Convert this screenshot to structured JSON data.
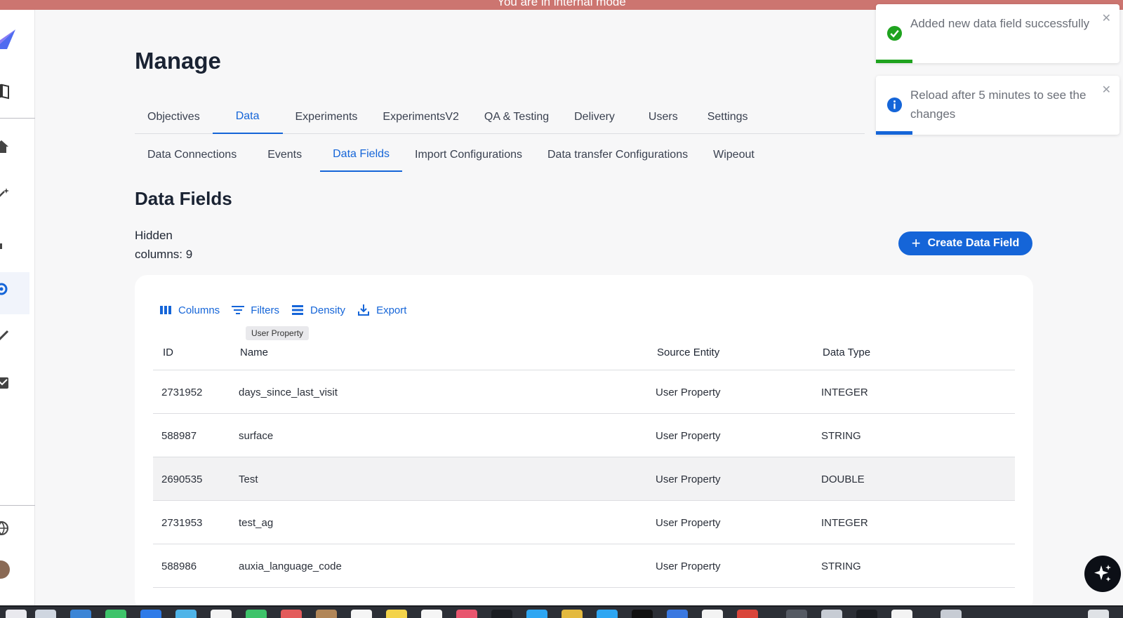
{
  "banner": {
    "text": "You are in internal mode"
  },
  "page": {
    "title": "Manage"
  },
  "tabs": [
    {
      "label": "Objectives",
      "active": false
    },
    {
      "label": "Data",
      "active": true
    },
    {
      "label": "Experiments",
      "active": false
    },
    {
      "label": "ExperimentsV2",
      "active": false
    },
    {
      "label": "QA & Testing",
      "active": false
    },
    {
      "label": "Delivery",
      "active": false
    },
    {
      "label": "Users",
      "active": false
    },
    {
      "label": "Settings",
      "active": false
    }
  ],
  "subtabs": [
    {
      "label": "Data Connections",
      "active": false
    },
    {
      "label": "Events",
      "active": false
    },
    {
      "label": "Data Fields",
      "active": true
    },
    {
      "label": "Import Configurations",
      "active": false
    },
    {
      "label": "Data transfer Configurations",
      "active": false
    },
    {
      "label": "Wipeout",
      "active": false
    }
  ],
  "section": {
    "title": "Data Fields",
    "hidden_columns": "Hidden columns: 9",
    "create_label": "Create Data Field"
  },
  "toolbar": {
    "columns_label": "Columns",
    "filters_label": "Filters",
    "density_label": "Density",
    "export_label": "Export"
  },
  "tooltip": {
    "text": "User Property"
  },
  "table": {
    "headers": [
      "ID",
      "Name",
      "Source Entity",
      "Data Type"
    ],
    "rows": [
      [
        "2731952",
        "days_since_last_visit",
        "User Property",
        "INTEGER"
      ],
      [
        "588987",
        "surface",
        "User Property",
        "STRING"
      ],
      [
        "2690535",
        "Test",
        "User Property",
        "DOUBLE"
      ],
      [
        "2731953",
        "test_ag",
        "User Property",
        "INTEGER"
      ],
      [
        "588986",
        "auxia_language_code",
        "User Property",
        "STRING"
      ]
    ]
  },
  "toasts": [
    {
      "message": "Added new data field successfully",
      "type": "success",
      "color": "#1fa31f"
    },
    {
      "message": "Reload after 5 minutes to see the changes",
      "type": "info",
      "color": "#1565d8"
    }
  ],
  "colors": {
    "accent": "#1565d8",
    "banner": "#cc7570"
  },
  "icons": {
    "sidebar": [
      "logo-icon",
      "book-icon",
      "home-icon",
      "magic-wand-icon",
      "bar-chart-icon",
      "gear-icon",
      "check-sparkle-icon",
      "image-chart-icon",
      "globe-icon",
      "avatar"
    ],
    "fab": "sparkle-icon"
  }
}
